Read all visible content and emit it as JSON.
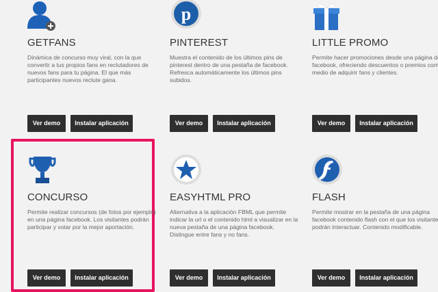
{
  "colors": {
    "highlight": "#e8135f",
    "button_bg": "#2f2f2f",
    "background": "#f2f2f2"
  },
  "apps": [
    {
      "name": "GETFANS",
      "icon": "user-add-icon",
      "description": "Dinámica de concurso muy viral, con la que convertir a tus propios fans en reclutadores de nuevos fans para tu página. El que más participantes nuevos reclute gana.",
      "demo_label": "Ver demo",
      "install_label": "Instalar aplicación"
    },
    {
      "name": "PINTEREST",
      "icon": "pinterest-icon",
      "description": "Muestra el contenido de los últimos pins de pinterest dentro de una pestaña de facebook. Refresca automáticamente los últimos pins subidos.",
      "demo_label": "Ver demo",
      "install_label": "Instalar aplicación"
    },
    {
      "name": "LITTLE PROMO",
      "icon": "gift-icon",
      "description": "Permite hacer promociones desde una página de facebook, ofreciendo descuentos o premios como medio de adquirir fans y clientes.",
      "demo_label": "Ver demo",
      "install_label": "Instalar aplicación"
    },
    {
      "name": "CONCURSO",
      "icon": "trophy-icon",
      "description": "Permite realizar concursos (de fotos por ejemplo) en una página facebook. Los visitantes podrán participar y votar por la mejor aportación.",
      "demo_label": "Ver demo",
      "install_label": "Instalar aplicación"
    },
    {
      "name": "EASYHTML PRO",
      "icon": "star-icon",
      "description": "Alternativa a la aplicación FBML que permite indicar la url o el contenido html a visualizar en la nueva pestaña de una página facebook. Distingue entre fans y no fans.",
      "demo_label": "Ver demo",
      "install_label": "Instalar aplicación"
    },
    {
      "name": "FLASH",
      "icon": "flash-icon",
      "description": "Permite mostrar en la pestaña de una página facebook contenido flash con el que los visitantes podrán interactuar. Contenido modificable.",
      "demo_label": "Ver demo",
      "install_label": "Instalar aplicación"
    }
  ]
}
